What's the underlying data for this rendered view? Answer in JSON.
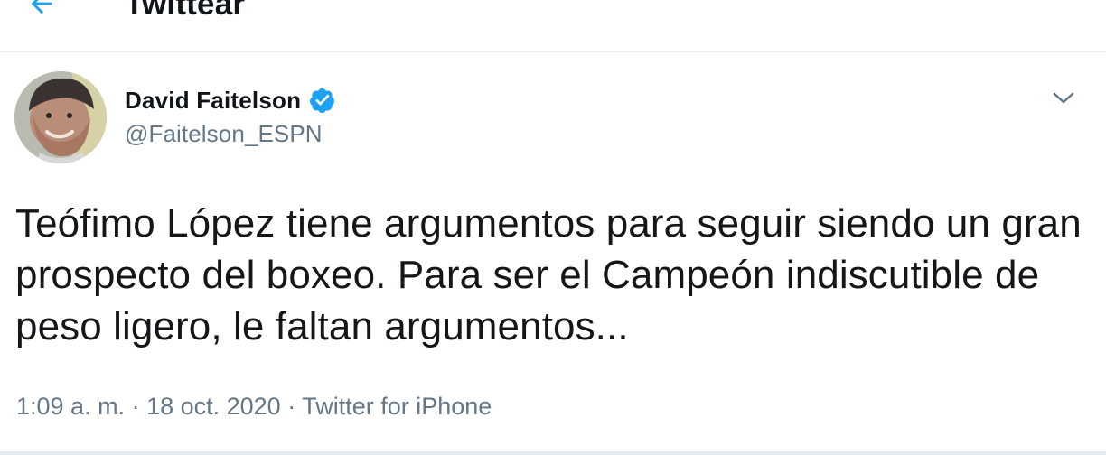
{
  "header": {
    "title": "Twittear",
    "back_icon": "arrow-left-icon",
    "accent_color": "#1da1f2"
  },
  "tweet": {
    "author": {
      "name": "David Faitelson",
      "handle": "@Faitelson_ESPN",
      "verified_icon": "verified-badge-icon",
      "verified_color": "#1da1f2"
    },
    "menu_icon": "chevron-down-icon",
    "text": "Teófimo López tiene argumentos para seguir siendo un gran prospecto del boxeo. Para ser el Campeón indiscutible de peso ligero, le faltan argumentos...",
    "meta": {
      "time": "1:09 a. m.",
      "separator": " · ",
      "date": "18 oct. 2020",
      "source": "Twitter for iPhone"
    }
  }
}
